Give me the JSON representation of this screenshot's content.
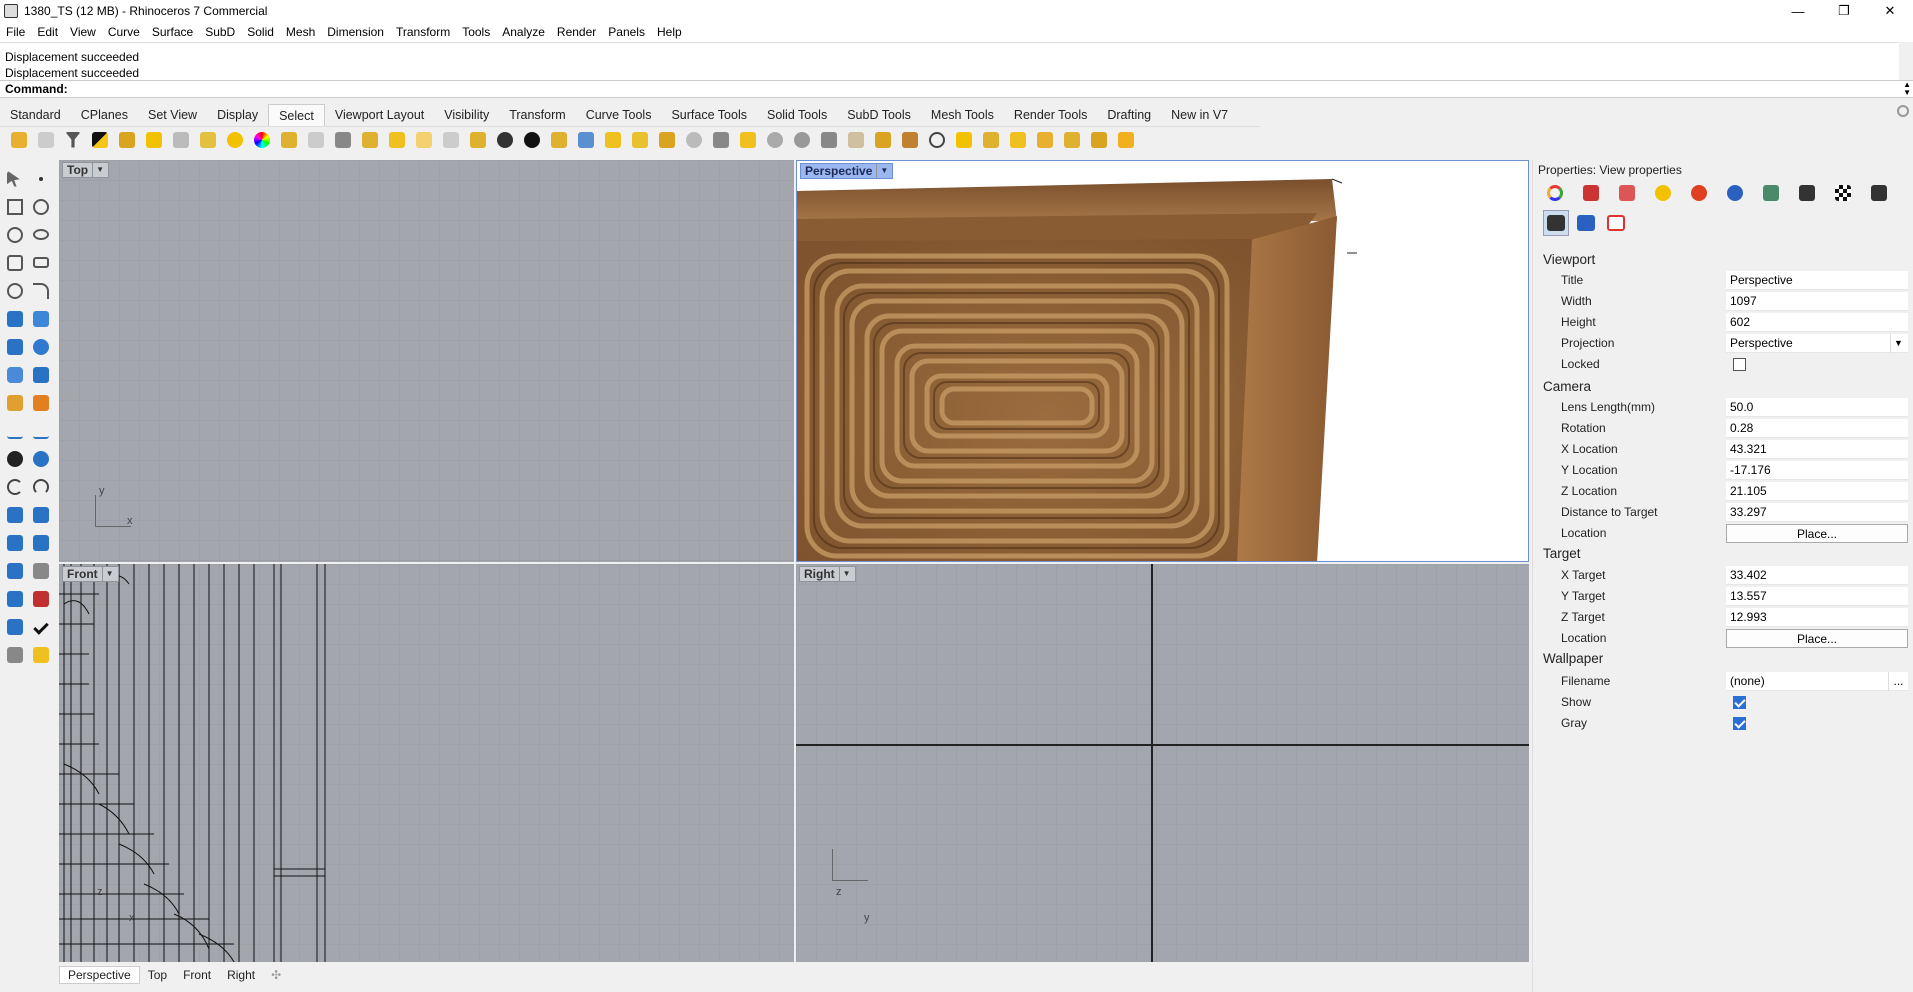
{
  "window": {
    "title": "1380_TS (12 MB) - Rhinoceros 7 Commercial",
    "minimize": "—",
    "maximize": "❐",
    "close": "✕"
  },
  "menu": [
    "File",
    "Edit",
    "View",
    "Curve",
    "Surface",
    "SubD",
    "Solid",
    "Mesh",
    "Dimension",
    "Transform",
    "Tools",
    "Analyze",
    "Render",
    "Panels",
    "Help"
  ],
  "command": {
    "history": [
      "Displacement succeeded",
      "Displacement succeeded"
    ],
    "prompt": "Command:"
  },
  "tabs": [
    "Standard",
    "CPlanes",
    "Set View",
    "Display",
    "Select",
    "Viewport Layout",
    "Visibility",
    "Transform",
    "Curve Tools",
    "Surface Tools",
    "Solid Tools",
    "SubD Tools",
    "Mesh Tools",
    "Render Tools",
    "Drafting",
    "New in V7"
  ],
  "active_tab": "Select",
  "viewports": {
    "top": {
      "label": "Top",
      "axis_x": "x",
      "axis_y": "y"
    },
    "perspective": {
      "label": "Perspective"
    },
    "front": {
      "label": "Front",
      "axis_x": "x",
      "axis_z": "z"
    },
    "right": {
      "label": "Right",
      "axis_y": "y",
      "axis_z": "z"
    }
  },
  "bottom_tabs": [
    "Perspective",
    "Top",
    "Front",
    "Right"
  ],
  "bottom_tab_add": "✣",
  "properties": {
    "header": "Properties: View properties",
    "viewport_section": "Viewport",
    "viewport": [
      {
        "label": "Title",
        "value": "Perspective"
      },
      {
        "label": "Width",
        "value": "1097"
      },
      {
        "label": "Height",
        "value": "602"
      },
      {
        "label": "Projection",
        "value": "Perspective"
      },
      {
        "label": "Locked",
        "value": ""
      }
    ],
    "camera_section": "Camera",
    "camera": [
      {
        "label": "Lens Length(mm)",
        "value": "50.0"
      },
      {
        "label": "Rotation",
        "value": "0.28"
      },
      {
        "label": "X Location",
        "value": "43.321"
      },
      {
        "label": "Y Location",
        "value": "-17.176"
      },
      {
        "label": "Z Location",
        "value": "21.105"
      },
      {
        "label": "Distance to Target",
        "value": "33.297"
      },
      {
        "label": "Location",
        "value": "Place..."
      }
    ],
    "target_section": "Target",
    "target": [
      {
        "label": "X Target",
        "value": "33.402"
      },
      {
        "label": "Y Target",
        "value": "13.557"
      },
      {
        "label": "Z Target",
        "value": "12.993"
      },
      {
        "label": "Location",
        "value": "Place..."
      }
    ],
    "wallpaper_section": "Wallpaper",
    "wallpaper": [
      {
        "label": "Filename",
        "value": "(none)"
      },
      {
        "label": "Show",
        "value": ""
      },
      {
        "label": "Gray",
        "value": ""
      }
    ],
    "filename_browse": "...",
    "locked": false,
    "show": true,
    "gray": true
  }
}
